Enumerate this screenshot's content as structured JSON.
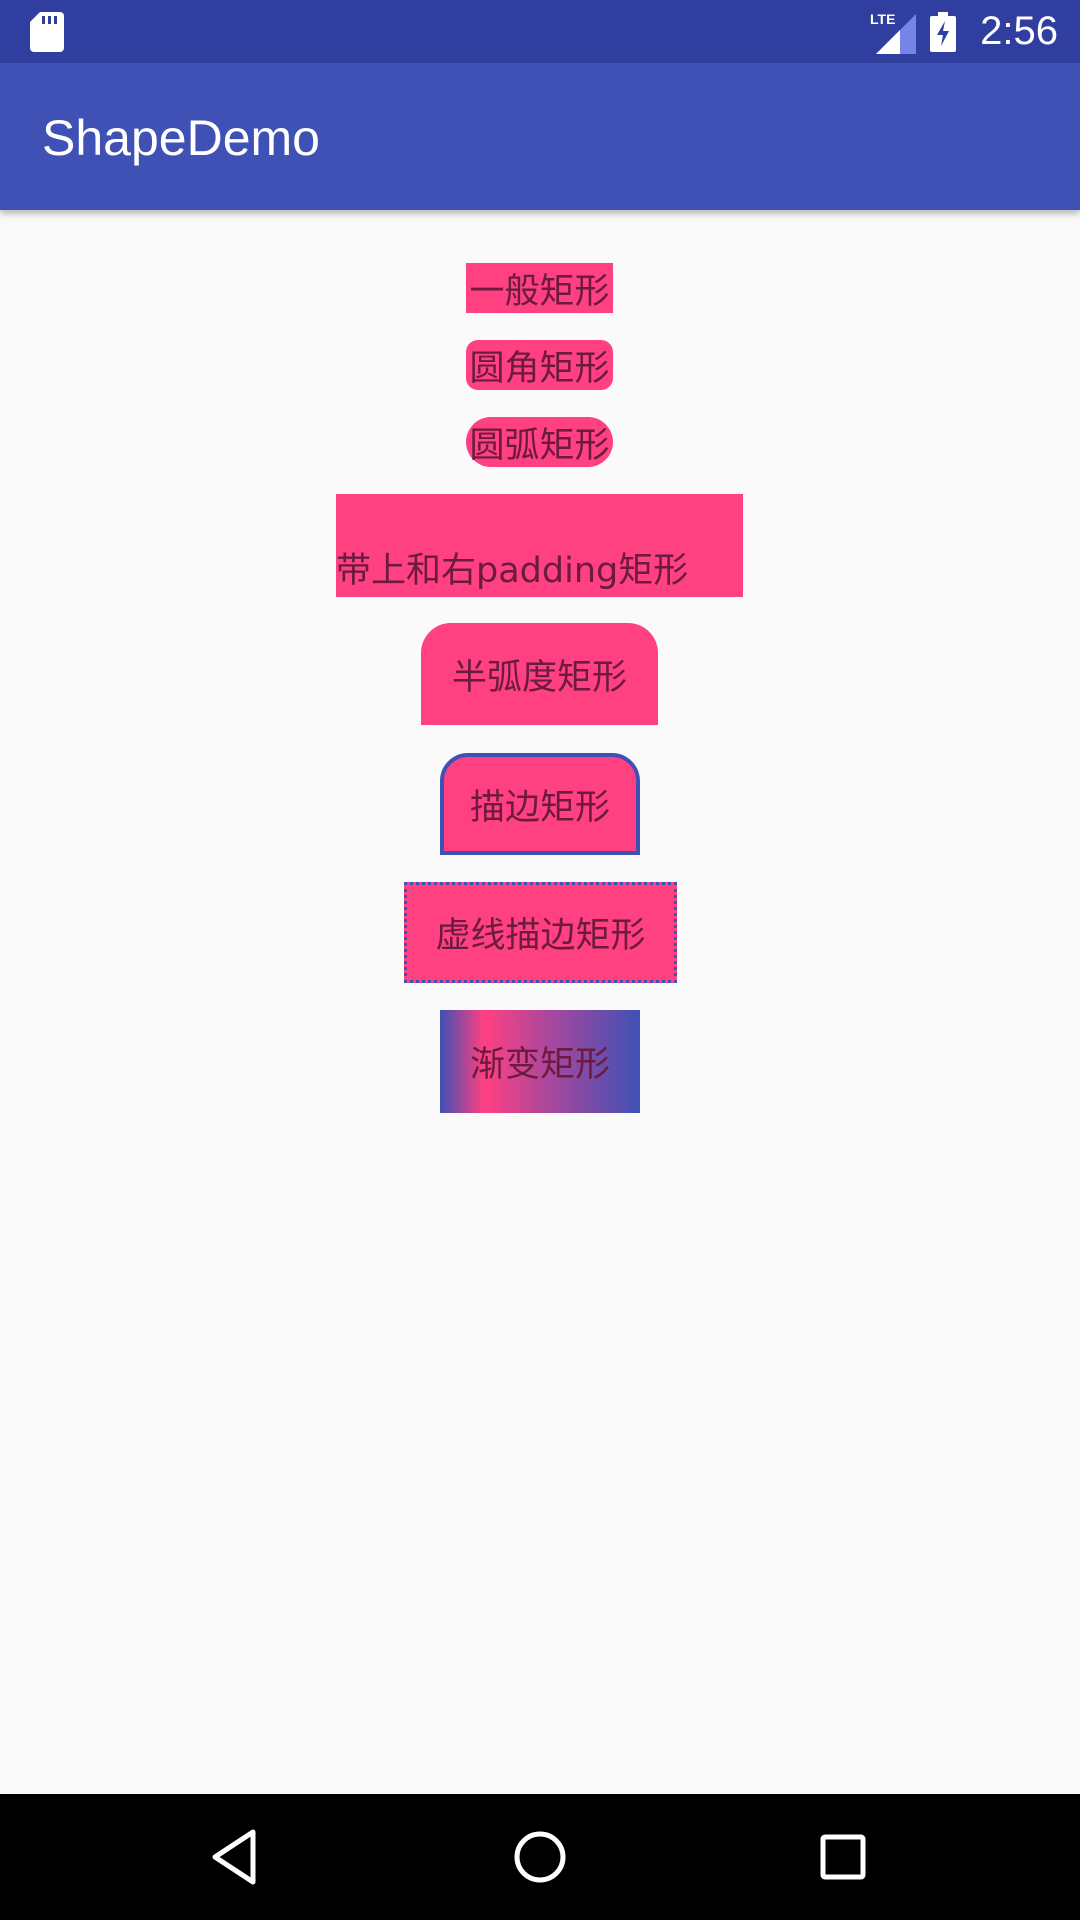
{
  "status_bar": {
    "time": "2:56",
    "network_label": "LTE",
    "icons": [
      "sd-card-icon",
      "signal-icon",
      "battery-charging-icon"
    ]
  },
  "app_bar": {
    "title": "ShapeDemo"
  },
  "shapes": [
    {
      "label": "一般矩形"
    },
    {
      "label": "圆角矩形"
    },
    {
      "label": "圆弧矩形"
    },
    {
      "label": "带上和右padding矩形"
    },
    {
      "label": "半弧度矩形"
    },
    {
      "label": "描边矩形"
    },
    {
      "label": "虚线描边矩形"
    },
    {
      "label": "渐变矩形"
    }
  ],
  "nav_bar": {
    "icons": [
      "back-icon",
      "home-icon",
      "recents-icon"
    ]
  },
  "colors": {
    "primary_dark": "#303f9f",
    "primary": "#3f51b5",
    "accent": "#ff4081",
    "background": "#fafafa"
  }
}
